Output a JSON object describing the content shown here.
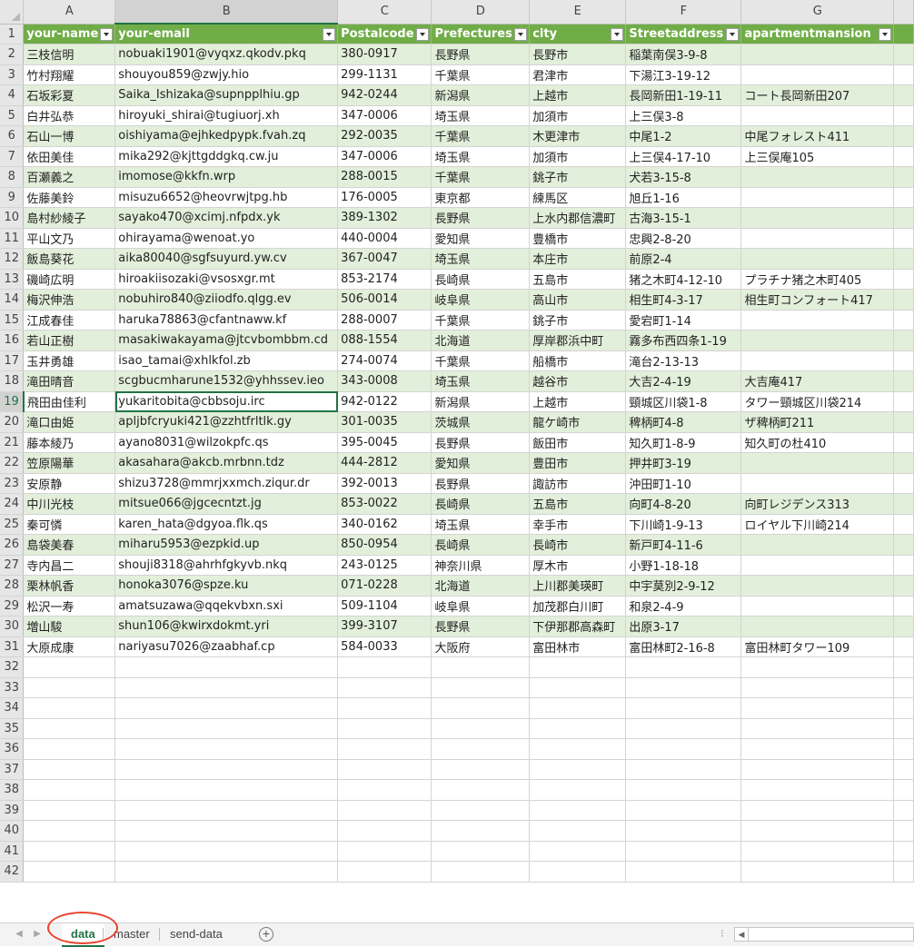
{
  "columns": [
    "A",
    "B",
    "C",
    "D",
    "E",
    "F",
    "G"
  ],
  "selected_column": "B",
  "headers": [
    "your-name",
    "your-email",
    "Postalcode",
    "Prefectures",
    "city",
    "Streetaddress",
    "apartmentmansion"
  ],
  "rows": [
    [
      "三枝信明",
      "nobuaki1901@vyqxz.qkodv.pkq",
      "380-0917",
      "長野県",
      "長野市",
      "稲葉南俣3-9-8",
      ""
    ],
    [
      "竹村翔耀",
      "shouyou859@zwjy.hio",
      "299-1131",
      "千葉県",
      "君津市",
      "下湯江3-19-12",
      ""
    ],
    [
      "石坂彩夏",
      "Saika_Ishizaka@supnpplhiu.gp",
      "942-0244",
      "新潟県",
      "上越市",
      "長岡新田1-19-11",
      "コート長岡新田207"
    ],
    [
      "白井弘恭",
      "hiroyuki_shirai@tugiuorj.xh",
      "347-0006",
      "埼玉県",
      "加須市",
      "上三俣3-8",
      ""
    ],
    [
      "石山一博",
      "oishiyama@ejhkedpypk.fvah.zq",
      "292-0035",
      "千葉県",
      "木更津市",
      "中尾1-2",
      "中尾フォレスト411"
    ],
    [
      "依田美佳",
      "mika292@kjttgddgkq.cw.ju",
      "347-0006",
      "埼玉県",
      "加須市",
      "上三俣4-17-10",
      "上三俣庵105"
    ],
    [
      "百瀬義之",
      "imomose@kkfn.wrp",
      "288-0015",
      "千葉県",
      "銚子市",
      "犬若3-15-8",
      ""
    ],
    [
      "佐藤美鈴",
      "misuzu6652@heovrwjtpg.hb",
      "176-0005",
      "東京都",
      "練馬区",
      "旭丘1-16",
      ""
    ],
    [
      "島村紗綾子",
      "sayako470@xcimj.nfpdx.yk",
      "389-1302",
      "長野県",
      "上水内郡信濃町",
      "古海3-15-1",
      ""
    ],
    [
      "平山文乃",
      "ohirayama@wenoat.yo",
      "440-0004",
      "愛知県",
      "豊橋市",
      "忠興2-8-20",
      ""
    ],
    [
      "飯島葵花",
      "aika80040@sgfsuyurd.yw.cv",
      "367-0047",
      "埼玉県",
      "本庄市",
      "前原2-4",
      ""
    ],
    [
      "磯崎広明",
      "hiroakiisozaki@vsosxgr.mt",
      "853-2174",
      "長崎県",
      "五島市",
      "猪之木町4-12-10",
      "プラチナ猪之木町405"
    ],
    [
      "梅沢伸浩",
      "nobuhiro840@ziiodfo.qlgg.ev",
      "506-0014",
      "岐阜県",
      "高山市",
      "相生町4-3-17",
      "相生町コンフォート417"
    ],
    [
      "江成春佳",
      "haruka78863@cfantnaww.kf",
      "288-0007",
      "千葉県",
      "銚子市",
      "愛宕町1-14",
      ""
    ],
    [
      "若山正樹",
      "masakiwakayama@jtcvbombbm.cd",
      "088-1554",
      "北海道",
      "厚岸郡浜中町",
      "霧多布西四条1-19",
      ""
    ],
    [
      "玉井勇雄",
      "isao_tamai@xhlkfol.zb",
      "274-0074",
      "千葉県",
      "船橋市",
      "滝台2-13-13",
      ""
    ],
    [
      "滝田晴音",
      "scgbucmharune1532@yhhssev.ieo",
      "343-0008",
      "埼玉県",
      "越谷市",
      "大吉2-4-19",
      "大吉庵417"
    ],
    [
      "飛田由佳利",
      "yukaritobita@cbbsoju.irc",
      "942-0122",
      "新潟県",
      "上越市",
      "頸城区川袋1-8",
      "タワー頸城区川袋214"
    ],
    [
      "滝口由姫",
      "apljbfcryuki421@zzhtfrltlk.gy",
      "301-0035",
      "茨城県",
      "龍ケ崎市",
      "稗柄町4-8",
      "ザ稗柄町211"
    ],
    [
      "藤本綾乃",
      "ayano8031@wilzokpfc.qs",
      "395-0045",
      "長野県",
      "飯田市",
      "知久町1-8-9",
      "知久町の杜410"
    ],
    [
      "笠原陽華",
      "akasahara@akcb.mrbnn.tdz",
      "444-2812",
      "愛知県",
      "豊田市",
      "押井町3-19",
      ""
    ],
    [
      "安原静",
      "shizu3728@mmrjxxmch.ziqur.dr",
      "392-0013",
      "長野県",
      "諏訪市",
      "沖田町1-10",
      ""
    ],
    [
      "中川光枝",
      "mitsue066@jgcecntzt.jg",
      "853-0022",
      "長崎県",
      "五島市",
      "向町4-8-20",
      "向町レジデンス313"
    ],
    [
      "秦可憐",
      "karen_hata@dgyoa.flk.qs",
      "340-0162",
      "埼玉県",
      "幸手市",
      "下川崎1-9-13",
      "ロイヤル下川崎214"
    ],
    [
      "島袋美春",
      "miharu5953@ezpkid.up",
      "850-0954",
      "長崎県",
      "長崎市",
      "新戸町4-11-6",
      ""
    ],
    [
      "寺内昌二",
      "shouji8318@ahrhfgkyvb.nkq",
      "243-0125",
      "神奈川県",
      "厚木市",
      "小野1-18-18",
      ""
    ],
    [
      "栗林帆香",
      "honoka3076@spze.ku",
      "071-0228",
      "北海道",
      "上川郡美瑛町",
      "中宇莫別2-9-12",
      ""
    ],
    [
      "松沢一寿",
      "amatsuzawa@qqekvbxn.sxi",
      "509-1104",
      "岐阜県",
      "加茂郡白川町",
      "和泉2-4-9",
      ""
    ],
    [
      "増山駿",
      "shun106@kwirxdokmt.yri",
      "399-3107",
      "長野県",
      "下伊那郡高森町",
      "出原3-17",
      ""
    ],
    [
      "大原成康",
      "nariyasu7026@zaabhaf.cp",
      "584-0033",
      "大阪府",
      "富田林市",
      "富田林町2-16-8",
      "富田林町タワー109"
    ]
  ],
  "empty_rows": [
    "32",
    "33",
    "34",
    "35",
    "36",
    "37",
    "38",
    "39",
    "40",
    "41",
    "42"
  ],
  "active_cell": {
    "row": 19,
    "col": "B"
  },
  "sheet_tabs": [
    "data",
    "master",
    "send-data"
  ],
  "active_tab": "data",
  "add_sheet_label": "+",
  "statusbar_ellipsis": "⁝",
  "colors": {
    "header_green": "#70ad47",
    "band_green": "#e2efda",
    "accent": "#217346",
    "highlight_ring": "#e8432e"
  },
  "icons": [
    "sheet-nav-prev-icon",
    "sheet-nav-next-icon",
    "add-sheet-icon",
    "filter-dropdown-icon",
    "scroll-left-icon"
  ]
}
